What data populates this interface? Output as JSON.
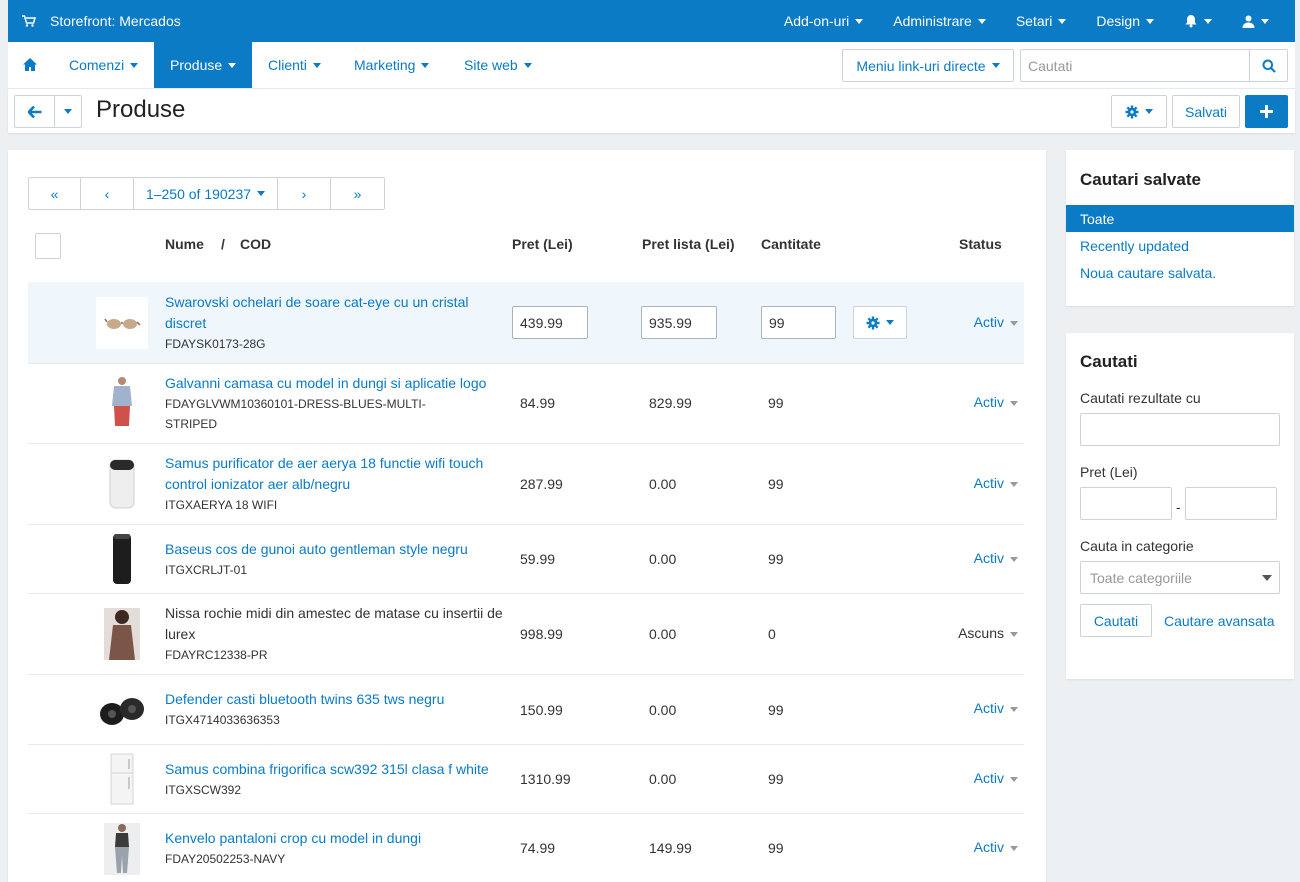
{
  "topbar": {
    "store": "Storefront: Mercados",
    "menu": [
      "Add-on-uri",
      "Administrare",
      "Setari",
      "Design"
    ]
  },
  "nav": {
    "items": [
      "Comenzi",
      "Produse",
      "Clienti",
      "Marketing",
      "Site web"
    ],
    "active": "Produse",
    "quicklinks": "Meniu link-uri directe",
    "search_placeholder": "Cautati"
  },
  "title": {
    "text": "Produse",
    "save": "Salvati"
  },
  "pager": {
    "first": "«",
    "prev": "‹",
    "range": "1–250 of 190237",
    "next": "›",
    "last": "»"
  },
  "table": {
    "headers": {
      "name": "Nume",
      "sep": "/",
      "code": "COD",
      "price": "Pret (Lei)",
      "list_price": "Pret lista (Lei)",
      "qty": "Cantitate",
      "status": "Status"
    },
    "rows": [
      {
        "name": "Swarovski ochelari de soare cat-eye cu un cristal discret",
        "sku": "FDAYSK0173-28G",
        "price": "439.99",
        "list_price": "935.99",
        "qty": "99",
        "status": "Activ",
        "thumb": "sunglasses"
      },
      {
        "name": "Galvanni camasa cu model in dungi si aplicatie logo",
        "sku": "FDAYGLVWM10360101-DRESS-BLUES-MULTI-STRIPED",
        "price": "84.99",
        "list_price": "829.99",
        "qty": "99",
        "status": "Activ",
        "thumb": "man-shirt"
      },
      {
        "name": "Samus purificator de aer aerya 18 functie wifi touch control ionizator aer alb/negru",
        "sku": "ITGXAERYA 18 WIFI",
        "price": "287.99",
        "list_price": "0.00",
        "qty": "99",
        "status": "Activ",
        "thumb": "air-purifier"
      },
      {
        "name": "Baseus cos de gunoi auto gentleman style negru",
        "sku": "ITGXCRLJT-01",
        "price": "59.99",
        "list_price": "0.00",
        "qty": "99",
        "status": "Activ",
        "thumb": "trash-bin"
      },
      {
        "name": "Nissa rochie midi din amestec de matase cu insertii de lurex",
        "sku": "FDAYRC12338-PR",
        "price": "998.99",
        "list_price": "0.00",
        "qty": "0",
        "status": "Ascuns",
        "thumb": "woman-dress"
      },
      {
        "name": "Defender casti bluetooth twins 635 tws negru",
        "sku": "ITGX4714033636353",
        "price": "150.99",
        "list_price": "0.00",
        "qty": "99",
        "status": "Activ",
        "thumb": "earbuds"
      },
      {
        "name": "Samus combina frigorifica scw392 315l clasa f white",
        "sku": "ITGXSCW392",
        "price": "1310.99",
        "list_price": "0.00",
        "qty": "99",
        "status": "Activ",
        "thumb": "fridge"
      },
      {
        "name": "Kenvelo pantaloni crop cu model in dungi",
        "sku": "FDAY20502253-NAVY",
        "price": "74.99",
        "list_price": "149.99",
        "qty": "99",
        "status": "Activ",
        "thumb": "woman-pants"
      }
    ]
  },
  "saved_searches": {
    "title": "Cautari salvate",
    "items": [
      "Toate",
      "Recently updated",
      "Noua cautare salvata."
    ]
  },
  "search_panel": {
    "title": "Cautati",
    "label_query": "Cautati rezultate cu",
    "label_price": "Pret (Lei)",
    "price_sep": "-",
    "label_category": "Cauta in categorie",
    "category_placeholder": "Toate categoriile",
    "search_button": "Cautati",
    "advanced_link": "Cautare avansata"
  },
  "colors": {
    "accent": "#0a7bc4",
    "selected_row": "#eff6fc",
    "background": "#edf0f3"
  }
}
